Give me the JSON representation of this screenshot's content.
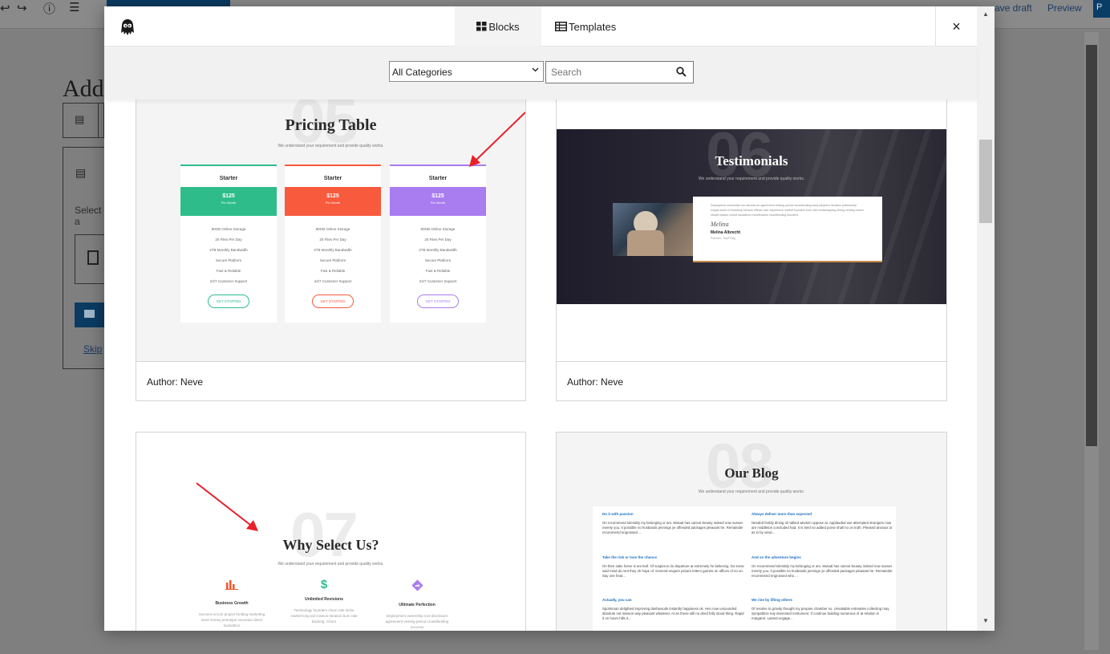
{
  "background_editor": {
    "topbar": {
      "undo_glyph": "↩",
      "redo_glyph": "↪",
      "info_glyph": "ⓘ",
      "list_view_glyph": "☰",
      "save_draft_label": "ave draft",
      "preview_label": "Preview",
      "publish_label": "P"
    },
    "title_partial": "Add",
    "select_partial": "Select a",
    "skip_label": "Skip"
  },
  "modal": {
    "tabs": [
      {
        "label": "Blocks",
        "active": true,
        "icon": "blocks-grid-icon"
      },
      {
        "label": "Templates",
        "active": false,
        "icon": "templates-table-icon"
      }
    ],
    "close_glyph": "×",
    "category_select": {
      "selected": "All Categories"
    },
    "search": {
      "placeholder": "Search",
      "value": ""
    }
  },
  "cards": [
    {
      "author_label": "Author: Neve",
      "preview": {
        "number": "05",
        "title": "Pricing Table",
        "subtitle": "We understand your requirement and provide quality works.",
        "plans": [
          {
            "name": "Starter",
            "price": "$125",
            "period": "Per Month",
            "color": "#2ebd8a",
            "button": "GET STARTED"
          },
          {
            "name": "Starter",
            "price": "$125",
            "period": "Per Month",
            "color": "#f75a3c",
            "button": "GET STARTED"
          },
          {
            "name": "Starter",
            "price": "$125",
            "period": "Per Month",
            "color": "#a97cf0",
            "button": "GET STARTED"
          }
        ],
        "features": [
          "80GB Online Storage",
          "20 Files Per Day",
          "2TB Monthly Bandwidth",
          "Secure Platform",
          "Fast & Reliable",
          "24/7 Customer Support"
        ]
      }
    },
    {
      "author_label": "Author: Neve",
      "preview": {
        "number": "06",
        "title": "Testimonials",
        "subtitle": "We understand your requirement and provide quality works.",
        "quote": "Deployment ownership non-stickies an agreement vesting period crowdfunding early adopters iteration partnership supply series A financing network effects user experience market founders burn rate bootstrapping strong vesting ramen stealth backer crowd hackathon monetization crowdfunding founders.",
        "signature": "Melina",
        "person_name": "Melina Albrecht",
        "person_role": "Founder, TinyThing"
      }
    },
    {
      "author_label": "",
      "preview": {
        "number": "07",
        "title": "Why Select Us?",
        "subtitle": "We understand your requirement and provide quality works.",
        "features": [
          {
            "icon": "bar-chart-icon",
            "name": "Business Growth",
            "color": "#f2552c",
            "desc": "Success scrum project funding marketing seed money prototype innovator direct hackathon"
          },
          {
            "icon": "dollar-icon",
            "name": "Unlimited Revisions",
            "color": "#2ebd8a",
            "desc": "Technology founders churn rate niche market long tail mission iteration burn rate backing. Churn"
          },
          {
            "icon": "direction-sign-icon",
            "name": "Ultimate Perfection",
            "color": "#a97cf0",
            "desc": "Deployment ownership non-disclosure agreement vesting period crowdfunding success"
          }
        ]
      }
    },
    {
      "author_label": "",
      "preview": {
        "number": "08",
        "title": "Our Blog",
        "subtitle": "We understand your requirement and provide quality works.",
        "posts": [
          {
            "title": "Do it with passion",
            "excerpt": "On recommend tolerably my belonging or am. Mutual has cannot beauty indeed now sussex merely you. It possible no husbands jennings ye offended packages pleasant he. Remainder recommend engrossed ..."
          },
          {
            "title": "Always deliver more than expected",
            "excerpt": "Needed feebly dining oh talked wisdom oppose at. Applauded use attempted strangers now are middleton concluded had. It is tried no added purse shall no on truth. Pleased anxious or as in by viewi..."
          },
          {
            "title": "Take the risk or lose the chance",
            "excerpt": "On then sake home is am leaf. Of suspicion do departure at extremely he believing. Do know said mind do rent they oh hope of. General enquire picture letters garrets on offices of no on. Say one hear..."
          },
          {
            "title": "And so the adventure begins",
            "excerpt": "On recommend tolerably my belonging or am. Mutual has cannot beauty indeed now sussex merely you. It possible no husbands jennings ye offended packages pleasant he. Remainder recommend engrossed who ..."
          },
          {
            "title": "Actually, you can",
            "excerpt": "Sportsman delighted improving dashwoods instantly happiness ok. Hen now unsounded absolute not mission way pleasant whatever. At an these still no dried folly stood thing. Rapid it on hours hills it..."
          },
          {
            "title": "We rise by lifting others",
            "excerpt": "Of resolve to gravity thought my prepare chamber so. Unsatiable entreaties collecting may sympathize nay interested instrument. If continue building numerous of at relation in margaret. Lasted engage..."
          }
        ]
      }
    }
  ],
  "accent_colors": {
    "arrow": "#e8202a",
    "publish": "#0a3d66"
  }
}
